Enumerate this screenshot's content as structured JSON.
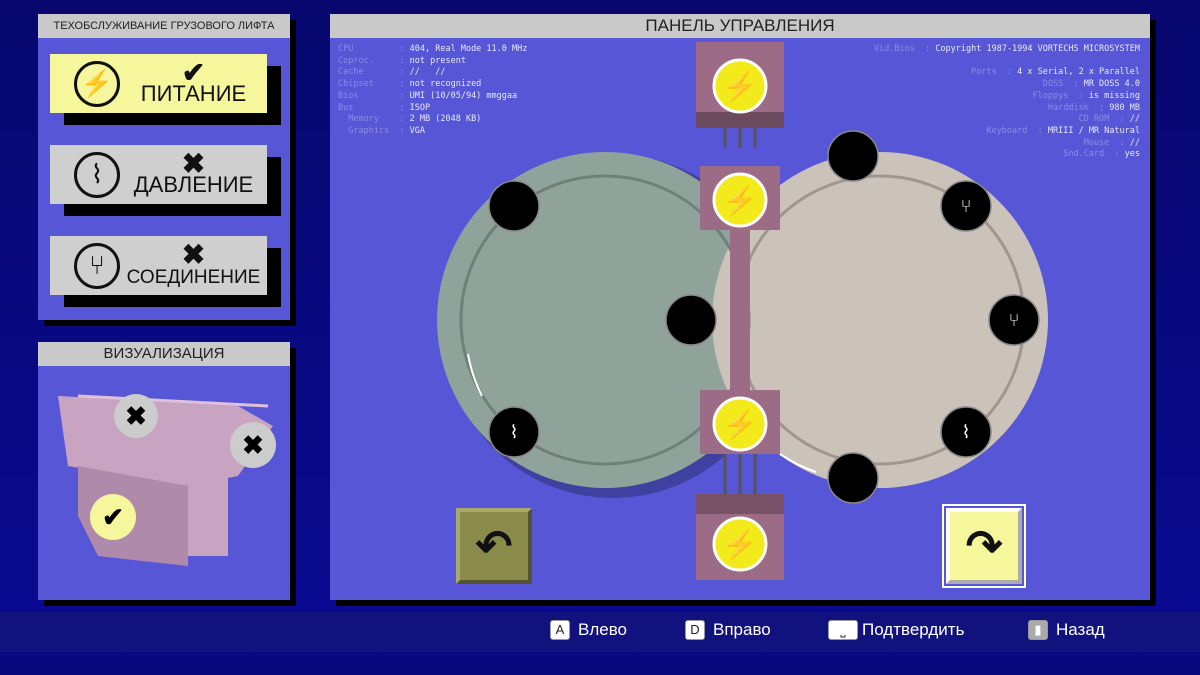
{
  "tasks_panel": {
    "title": "ТЕХОБСЛУЖИВАНИЕ ГРУЗОВОГО ЛИФТА",
    "items": [
      {
        "label": "ПИТАНИЕ",
        "status": "✔",
        "icon": "⚡"
      },
      {
        "label": "ДАВЛЕНИЕ",
        "status": "✖",
        "icon": "⌇"
      },
      {
        "label": "СОЕДИНЕНИЕ",
        "status": "✖",
        "icon": "⑂"
      }
    ]
  },
  "viz_panel": {
    "title": "ВИЗУАЛИЗАЦИЯ",
    "markers": [
      "✖",
      "✖",
      "✔"
    ]
  },
  "control_panel": {
    "title": "ПАНЕЛЬ УПРАВЛЕНИЯ",
    "bios_left": [
      [
        "CPU",
        "404, Real Mode 11.0 MHz"
      ],
      [
        "Coproc.",
        "not present"
      ],
      [
        "Cache",
        "//   //"
      ],
      [
        "Chipset",
        "not recognized"
      ],
      [
        "Bios",
        "UMI (10/05/94) mmggaa"
      ],
      [
        "Bus",
        "ISOP"
      ],
      [
        "  Memory",
        "2 MB (2048 KB)"
      ],
      [
        "  Graphics",
        "VGA"
      ]
    ],
    "bios_right": [
      [
        "Vid.Bios",
        "Copyright 1987-1994 VORTECHS MICROSYSTEM"
      ],
      [
        "",
        ""
      ],
      [
        "Ports",
        "4 x Serial, 2 x Parallel"
      ],
      [
        "DOSS",
        "MR DOSS 4.0"
      ],
      [
        "Floppys",
        "is missing"
      ],
      [
        "Harddisk",
        "980 MB"
      ],
      [
        "CD ROM",
        "//"
      ],
      [
        "Keyboard",
        "MRIII / MR Natural"
      ],
      [
        "Mouse",
        "//"
      ],
      [
        "Snd.Card",
        "yes"
      ]
    ],
    "rotate_left": "↶",
    "rotate_right": "↷",
    "colors": {
      "left_disc": "#8fa39b",
      "right_disc": "#cbc3ba",
      "module": "#9c6c86",
      "power": "#f2ea1a"
    }
  },
  "hints": [
    {
      "key": "A",
      "label": "Влево"
    },
    {
      "key": "D",
      "label": "Вправо"
    },
    {
      "key": "⎵",
      "label": "Подтвердить"
    },
    {
      "key": "▮",
      "label": "Назад"
    }
  ]
}
